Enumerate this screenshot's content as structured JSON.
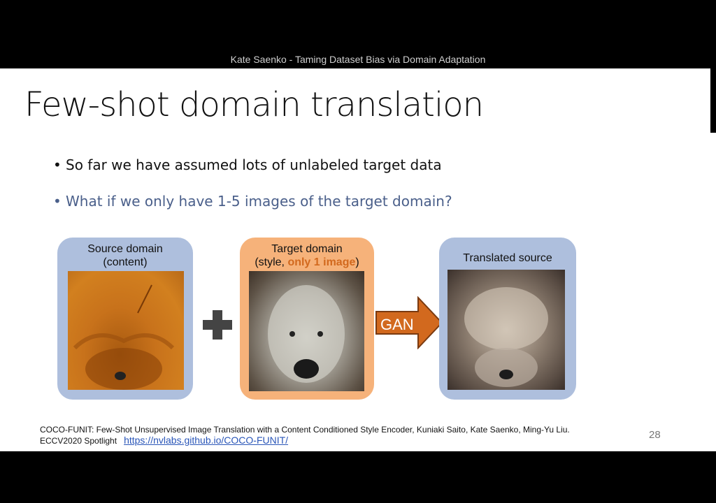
{
  "header": {
    "caption": "Kate Saenko - Taming Dataset Bias via Domain Adaptation"
  },
  "slide": {
    "title": "Few-shot domain translation",
    "bullets": [
      "So far we have assumed lots of unlabeled target data",
      "What if we only have 1-5 images of the target domain?"
    ],
    "bullet_marker": "•",
    "panels": {
      "source": {
        "line1": "Source domain",
        "line2": "(content)"
      },
      "target": {
        "line1": "Target domain",
        "line2_prefix": "(style, ",
        "line2_highlight": "only 1 image",
        "line2_suffix": ")"
      },
      "output": {
        "label": "Translated source"
      }
    },
    "arrow_label": "GAN",
    "footnote": {
      "line1": "COCO-FUNIT: Few-Shot Unsupervised Image Translation with a Content Conditioned Style Encoder, Kuniaki Saito, Kate Saenko, Ming-Yu Liu.",
      "line2": "ECCV2020 Spotlight",
      "link": "https://nvlabs.github.io/COCO-FUNIT/"
    },
    "page_number": "28"
  },
  "colors": {
    "panel_blue": "#aebfdd",
    "panel_orange": "#f6b27a",
    "arrow_fill": "#d2691e",
    "highlight_text": "#d2691e",
    "bullet2_text": "#4a5f8a"
  },
  "icons": {
    "plus": "plus-icon",
    "arrow": "right-arrow-icon"
  }
}
